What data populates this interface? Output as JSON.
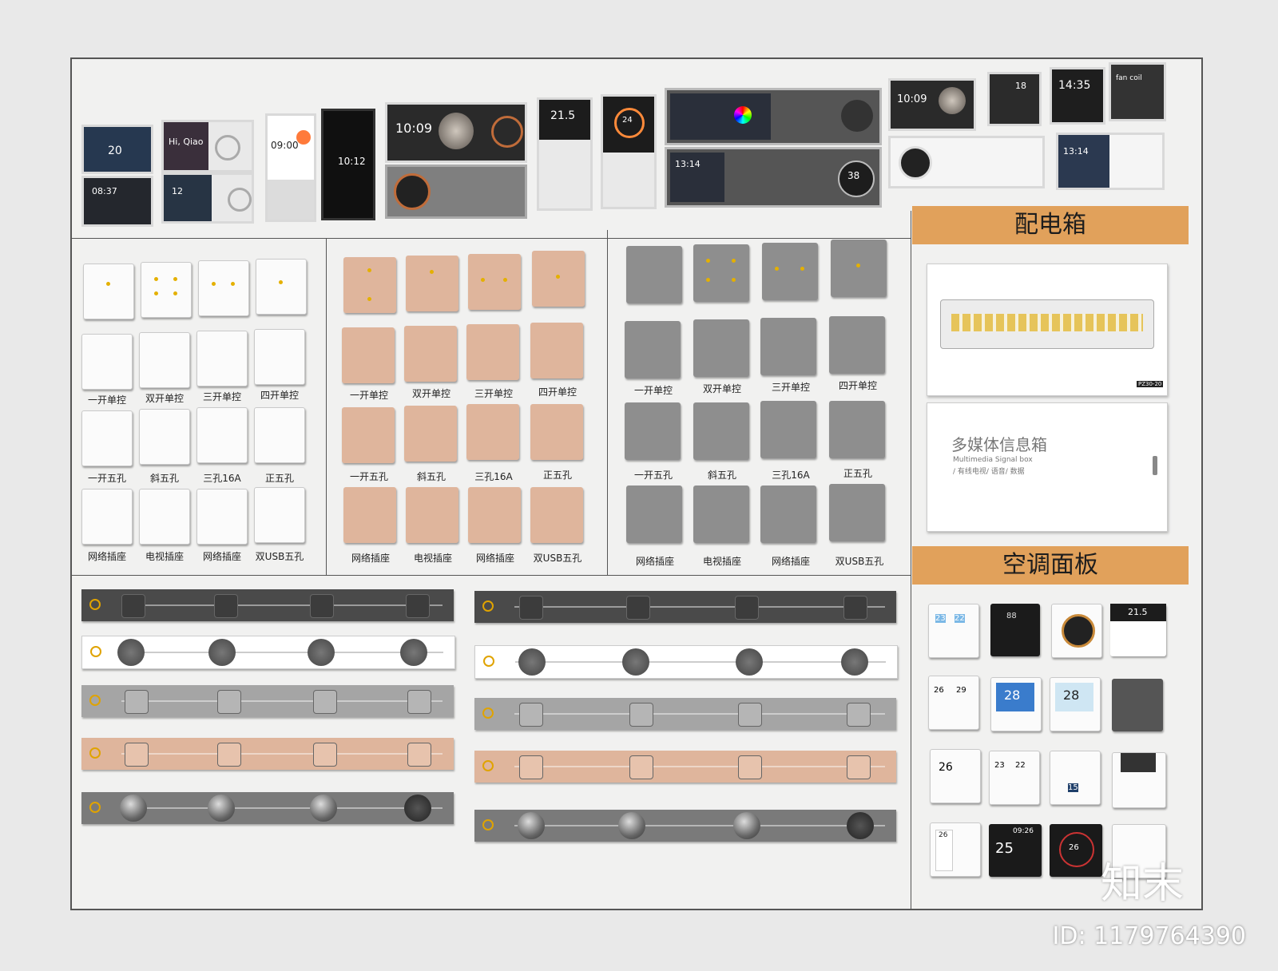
{
  "screens": [
    {
      "time": "20",
      "sub": ""
    },
    {
      "time": "08:37",
      "sub": ""
    },
    {
      "time": "Hi, Qiao",
      "sub": ""
    },
    {
      "time": "12",
      "sub": ""
    },
    {
      "time": "09:00",
      "sub": ""
    },
    {
      "time": "10:12",
      "sub": ""
    },
    {
      "time": "10:09",
      "sub": ""
    },
    {
      "time": "21.5",
      "sub": ""
    },
    {
      "time": "24",
      "sub": ""
    },
    {
      "time": "13:14",
      "sub": ""
    },
    {
      "time": "38",
      "sub": ""
    },
    {
      "time": "10:09",
      "sub": ""
    },
    {
      "time": "18",
      "sub": ""
    },
    {
      "time": "14:35",
      "sub": ""
    },
    {
      "time": "fan coil",
      "sub": ""
    },
    {
      "time": "13:14",
      "sub": ""
    }
  ],
  "switch_labels": [
    "一开单控",
    "双开单控",
    "三开单控",
    "四开单控"
  ],
  "socket_labels": [
    "一开五孔",
    "斜五孔",
    "三孔16A",
    "正五孔"
  ],
  "data_labels": [
    "网络插座",
    "电视插座",
    "网络插座",
    "双USB五孔"
  ],
  "sections": {
    "distribution_box": "配电箱",
    "ac_panel": "空调面板",
    "multimedia_title": "多媒体信息箱",
    "multimedia_sub": "Multimedia Signal box",
    "multimedia_sub2": "/ 有线电视/ 语音/ 数据",
    "box_model": "PZ30-20"
  },
  "ac_displays": [
    "23",
    "22",
    "88",
    "21.5",
    "26",
    "29",
    "28",
    "28",
    "26",
    "23",
    "22",
    "15",
    "26",
    "25",
    "09:26",
    "26"
  ],
  "watermark": "知末",
  "id_text": "ID: 1179764390",
  "colors": {
    "board": "#f1f1f0",
    "accent": "#e1a15b",
    "pink": "#dfb59c",
    "gray": "#8e8e8e"
  }
}
